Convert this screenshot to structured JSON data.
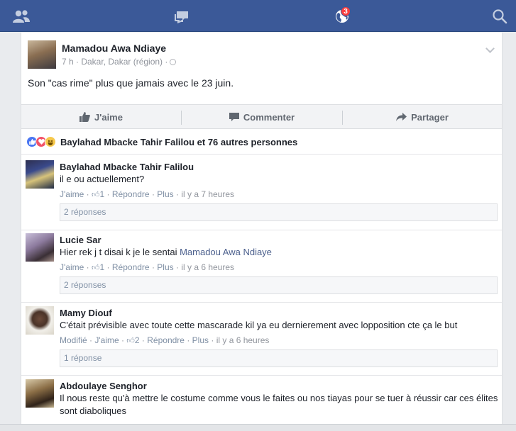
{
  "nav": {
    "friends_icon": "friends-icon",
    "messages_icon": "messages-icon",
    "notifications_icon": "globe-icon",
    "notifications_count": "3",
    "search_icon": "search-icon",
    "bar_color": "#3b5998"
  },
  "post": {
    "author": "Mamadou Awa Ndiaye",
    "meta": "7 h · Dakar, Dakar (région) ·",
    "text": "Son \"cas rime\" plus que jamais avec le 23 juin.",
    "actions": {
      "like": "J'aime",
      "comment": "Commenter",
      "share": "Partager"
    },
    "reactions_text": "Baylahad Mbacke Tahir Falilou et 76 autres personnes"
  },
  "comments": [
    {
      "name": "Baylahad Mbacke Tahir Falilou",
      "text": "il e ou actuellement?",
      "like": "J'aime",
      "likes": "1",
      "reply": "Répondre",
      "more": "Plus",
      "time": "il y a 7 heures",
      "replies": "2 réponses"
    },
    {
      "name": "Lucie Sar",
      "text": "Hier rek j t disai k je le sentai",
      "mention": "Mamadou Awa Ndiaye",
      "like": "J'aime",
      "likes": "1",
      "reply": "Répondre",
      "more": "Plus",
      "time": "il y a 6 heures",
      "replies": "2 réponses"
    },
    {
      "name": "Mamy Diouf",
      "text": "C'était prévisible avec toute cette mascarade kil ya eu dernierement avec lopposition cte ça le but",
      "modified": "Modifié",
      "like": "J'aime",
      "likes": "2",
      "reply": "Répondre",
      "more": "Plus",
      "time": "il y a 6 heures",
      "replies": "1 réponse"
    },
    {
      "name": "Abdoulaye Senghor",
      "text": "Il nous reste qu'à mettre le costume comme vous le faites ou nos tiayas pour se tuer à réussir car ces élites sont diaboliques"
    }
  ]
}
